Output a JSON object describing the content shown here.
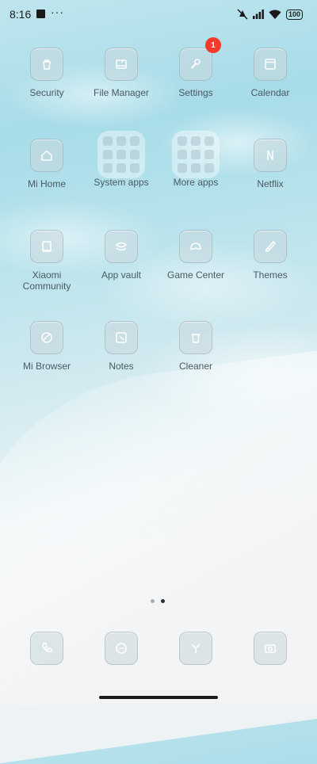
{
  "status_bar": {
    "time": "8:16",
    "notification_more": "···",
    "battery": "100",
    "icons": [
      "square-notification-icon",
      "mute-icon",
      "signal-icon",
      "wifi-icon",
      "battery-icon"
    ]
  },
  "apps": [
    {
      "label": "Security",
      "icon": "security-icon"
    },
    {
      "label": "File Manager",
      "icon": "file-manager-icon"
    },
    {
      "label": "Settings",
      "icon": "settings-icon",
      "badge": "1"
    },
    {
      "label": "Calendar",
      "icon": "calendar-icon"
    },
    {
      "label": "Mi Home",
      "icon": "home-icon"
    },
    {
      "label": "System apps",
      "icon": "folder-icon"
    },
    {
      "label": "More apps",
      "icon": "folder-icon"
    },
    {
      "label": "Netflix",
      "icon": "netflix-icon"
    },
    {
      "label": "Xiaomi Community",
      "icon": "community-icon"
    },
    {
      "label": "App vault",
      "icon": "app-vault-icon"
    },
    {
      "label": "Game Center",
      "icon": "game-center-icon"
    },
    {
      "label": "Themes",
      "icon": "themes-icon"
    },
    {
      "label": "Mi Browser",
      "icon": "browser-icon"
    },
    {
      "label": "Notes",
      "icon": "notes-icon"
    },
    {
      "label": "Cleaner",
      "icon": "cleaner-icon"
    }
  ],
  "dock": [
    {
      "icon": "phone-icon"
    },
    {
      "icon": "messages-icon"
    },
    {
      "icon": "browser-icon"
    },
    {
      "icon": "camera-icon"
    }
  ],
  "pager": {
    "pages": 2,
    "current": 2
  },
  "colors": {
    "badge": "#f23b2a"
  }
}
